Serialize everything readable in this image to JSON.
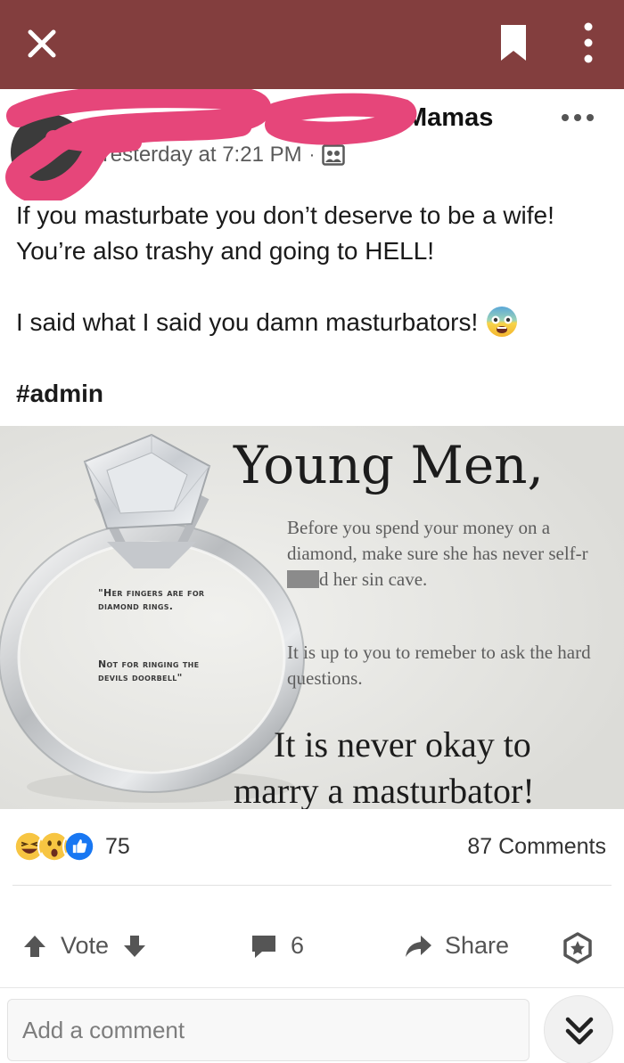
{
  "topbar": {
    "close_icon": "close-icon",
    "bookmark_icon": "bookmark-icon",
    "menu_icon": "vertical-dots-icon",
    "background": "#833e3e"
  },
  "post": {
    "group_name": "Mamas",
    "timestamp": "Yesterday at 7:21 PM",
    "separator": "·",
    "privacy_icon": "group-icon",
    "more_icon": "horizontal-dots-icon",
    "text_line1": "If you masturbate you don’t deserve to be a wife! You’re also trashy and going to HELL!",
    "text_line2": "I said what I said you damn masturbators!",
    "emoji": "fearful-face-emoji",
    "hashtag": "#admin"
  },
  "image": {
    "headline": "Young Men,",
    "para1_part1": "Before you spend your money on a diamond, make sure she has never self-r",
    "para1_part2": "d her sin cave.",
    "para2": "It is up to you to remeber to ask the hard questions.",
    "tag1": "\"Her fingers are for diamond rings.",
    "tag2": "Not for ringing the devils doorbell\"",
    "footer_line1": "It is never okay to",
    "footer_line2": "marry a masturbator!"
  },
  "stats": {
    "reactions": [
      "laughing-reaction",
      "wow-reaction",
      "like-reaction"
    ],
    "reaction_count": "75",
    "comments": "87 Comments"
  },
  "actions": {
    "vote_label": "Vote",
    "comment_count": "6",
    "share_label": "Share",
    "award_icon": "award-icon"
  },
  "comment_bar": {
    "placeholder": "Add a comment",
    "expand_icon": "double-chevron-down-icon"
  }
}
